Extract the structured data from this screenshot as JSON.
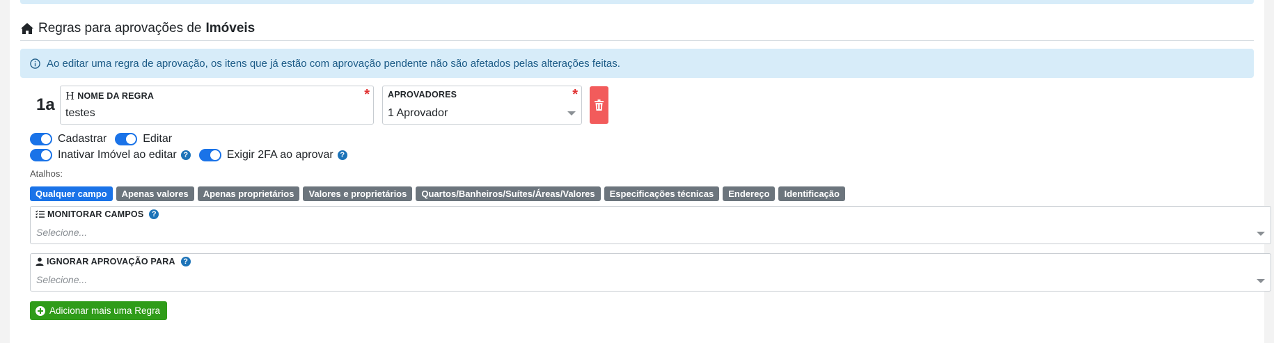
{
  "header": {
    "title_prefix": "Regras para aprovações de",
    "title_entity": "Imóveis"
  },
  "alert": {
    "text": "Ao editar uma regra de aprovação, os itens que já estão com aprovação pendente não são afetados pelas alterações feitas."
  },
  "rule": {
    "number": "1a",
    "name_label": "NOME DA REGRA",
    "name_value": "testes",
    "approvers_label": "APROVADORES",
    "approvers_value": "1 Aprovador",
    "required_mark": "*"
  },
  "toggles": {
    "cadastrar": "Cadastrar",
    "editar": "Editar",
    "inativar": "Inativar Imóvel ao editar",
    "exigir_2fa": "Exigir 2FA ao aprovar"
  },
  "shortcuts": {
    "label": "Atalhos:",
    "items": [
      "Qualquer campo",
      "Apenas valores",
      "Apenas proprietários",
      "Valores e proprietários",
      "Quartos/Banheiros/Suítes/Áreas/Valores",
      "Especificações técnicas",
      "Endereço",
      "Identificação"
    ]
  },
  "monitor": {
    "label": "MONITORAR CAMPOS",
    "placeholder": "Selecione..."
  },
  "ignore": {
    "label": "IGNORAR APROVAÇÃO PARA",
    "placeholder": "Selecione..."
  },
  "add_button": {
    "label": "Adicionar mais uma Regra"
  },
  "colors": {
    "primary": "#1a73e8",
    "danger": "#f25b5b",
    "success": "#2f9c19",
    "secondary": "#6c757d",
    "info_bg": "#d7ecf9"
  }
}
